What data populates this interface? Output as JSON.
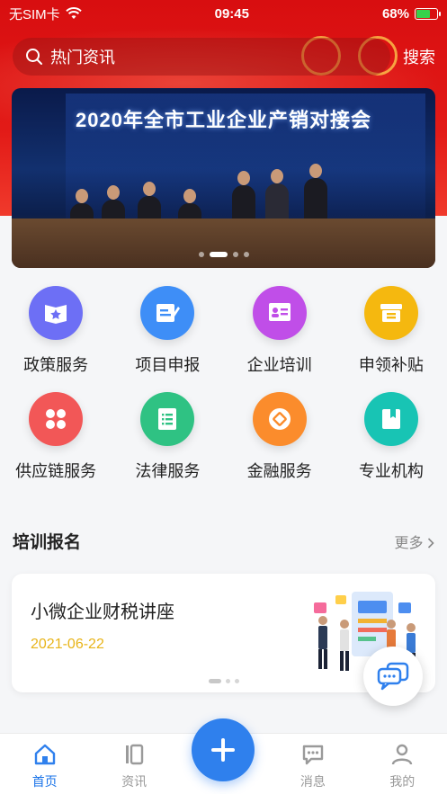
{
  "status_bar": {
    "carrier": "无SIM卡",
    "time": "09:45",
    "battery": "68%",
    "battery_level": 0.68
  },
  "search": {
    "placeholder": "热门资讯",
    "button_label": "搜索"
  },
  "banner": {
    "title": "2020年全市工业企业产销对接会",
    "slide_count": 4,
    "active_slide": 1
  },
  "services": [
    {
      "label": "政策服务",
      "icon": "policy-card-icon",
      "color": "#6d6ff5"
    },
    {
      "label": "项目申报",
      "icon": "edit-document-icon",
      "color": "#3e8ef7"
    },
    {
      "label": "企业培训",
      "icon": "training-board-icon",
      "color": "#c04ee8"
    },
    {
      "label": "申领补贴",
      "icon": "subsidy-box-icon",
      "color": "#f5b80f"
    },
    {
      "label": "供应链服务",
      "icon": "supply-grid-icon",
      "color": "#f25757"
    },
    {
      "label": "法律服务",
      "icon": "law-list-icon",
      "color": "#2fc283"
    },
    {
      "label": "金融服务",
      "icon": "finance-coin-icon",
      "color": "#fb8c2c"
    },
    {
      "label": "专业机构",
      "icon": "agency-book-icon",
      "color": "#18c4b4"
    }
  ],
  "training_section": {
    "title": "培训报名",
    "more_label": "更多",
    "card": {
      "title": "小微企业财税讲座",
      "date": "2021-06-22"
    }
  },
  "tab_bar": {
    "items": [
      {
        "label": "首页",
        "icon": "home-icon",
        "active": true
      },
      {
        "label": "资讯",
        "icon": "news-icon",
        "active": false
      },
      {
        "label": "消息",
        "icon": "message-icon",
        "active": false
      },
      {
        "label": "我的",
        "icon": "profile-icon",
        "active": false
      }
    ],
    "fab_icon": "plus-icon"
  },
  "colors": {
    "primary": "#2f80ed",
    "header_red": "#d80e10",
    "date_yellow": "#e8b418"
  }
}
